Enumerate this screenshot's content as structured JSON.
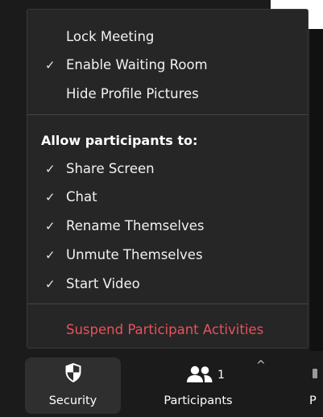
{
  "menu": {
    "top_items": [
      {
        "label": "Lock Meeting",
        "checked": false
      },
      {
        "label": "Enable Waiting Room",
        "checked": true
      },
      {
        "label": "Hide Profile Pictures",
        "checked": false
      }
    ],
    "section_heading": "Allow participants to:",
    "allow_items": [
      {
        "label": "Share Screen",
        "checked": true
      },
      {
        "label": "Chat",
        "checked": true
      },
      {
        "label": "Rename Themselves",
        "checked": true
      },
      {
        "label": "Unmute Themselves",
        "checked": true
      },
      {
        "label": "Start Video",
        "checked": true
      }
    ],
    "danger_item": "Suspend Participant Activities",
    "check_glyph": "✓"
  },
  "toolbar": {
    "security_label": "Security",
    "participants_label": "Participants",
    "participants_count": "1",
    "next_label_partial": "P",
    "caret_glyph": "^",
    "icons": {
      "security": "shield-icon",
      "participants": "participants-icon",
      "options": "chevron-up-icon"
    }
  },
  "colors": {
    "menu_bg": "#262626",
    "danger": "#e8525b",
    "toolbar_bg": "#1b1b1b",
    "active_btn_bg": "#2f2f2f"
  }
}
